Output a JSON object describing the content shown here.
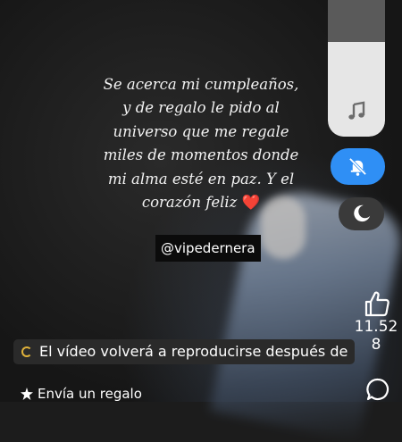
{
  "quote": {
    "lines": [
      "Se acerca mi cumpleaños,",
      "y de regalo le pido al",
      "universo que me regale",
      "miles de momentos donde",
      "mi alma esté en paz. Y el",
      "corazón feliz"
    ],
    "emoji": "❤️"
  },
  "handle": "@vipedernera",
  "controls": {
    "volume_level_percent": 65,
    "music_icon": "music-note-icon",
    "mute_icon": "bell-off-icon",
    "dark_mode_icon": "moon-icon",
    "accent_color": "#2f8ff5"
  },
  "likes": {
    "count_line1": "11.52",
    "count_line2": "8"
  },
  "notice": {
    "text": "El vídeo volverá a reproducirse después de"
  },
  "gift": {
    "label": "Envía un regalo"
  }
}
